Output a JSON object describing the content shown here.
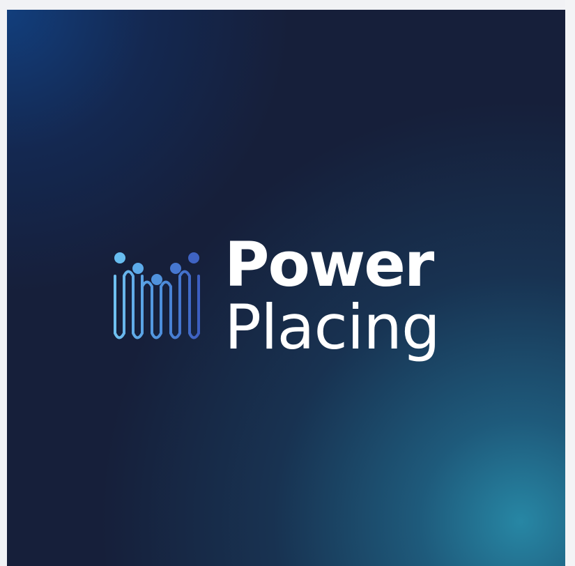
{
  "brand": {
    "name_line_1": "Power",
    "name_line_2": "Placing",
    "logo_icon": "people-wave-logo-icon"
  },
  "colors": {
    "background": "#161f3a",
    "accent_glow": "#2688a8",
    "text": "#ffffff",
    "logo_light_blue": "#67b9ea",
    "logo_mid_blue": "#4d86d6",
    "logo_dark_blue": "#3e63c3"
  }
}
